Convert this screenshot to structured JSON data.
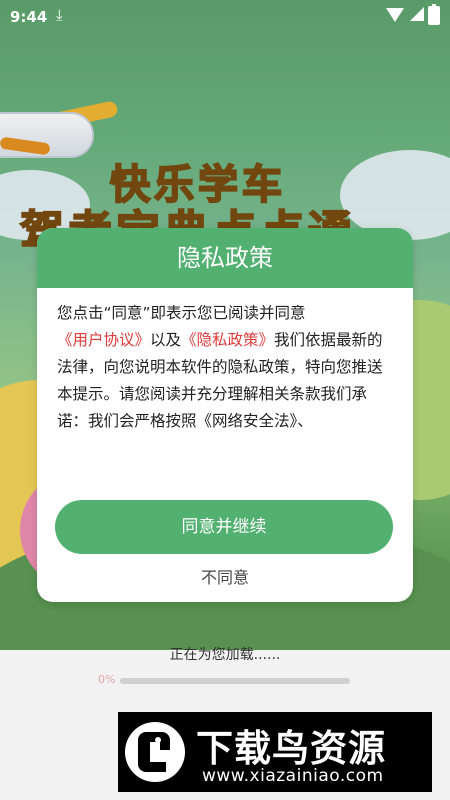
{
  "status_bar": {
    "time": "9:44",
    "download_glyph": "⤓",
    "icons": [
      "download-icon",
      "wifi-icon",
      "signal-icon",
      "battery-icon"
    ]
  },
  "background": {
    "title_line1": "快乐学车",
    "title_line2": "驾考宝典点点通"
  },
  "dialog": {
    "title": "隐私政策",
    "body_part1": "您点击“同意”即表示您已阅读并同意",
    "link_user_agreement": "《用户协议》",
    "body_part2": "以及",
    "link_privacy_policy": "《隐私政策》",
    "body_part3": "我们依据最新的法律，向您说明本软件的隐私政策，特向您推送本提示。请您阅读并充分理解相关条款我们承诺：我们会严格按照《网络安全法》、",
    "agree_button": "同意并继续",
    "disagree_button": "不同意"
  },
  "loading": {
    "text": "正在为您加载......",
    "percent_label": "0%",
    "progress": 0
  },
  "watermark": {
    "brand": "下载鸟资源",
    "url": "www.xiazainiao.com"
  },
  "colors": {
    "accent_green": "#52b070",
    "link_red": "#e23b3b"
  }
}
